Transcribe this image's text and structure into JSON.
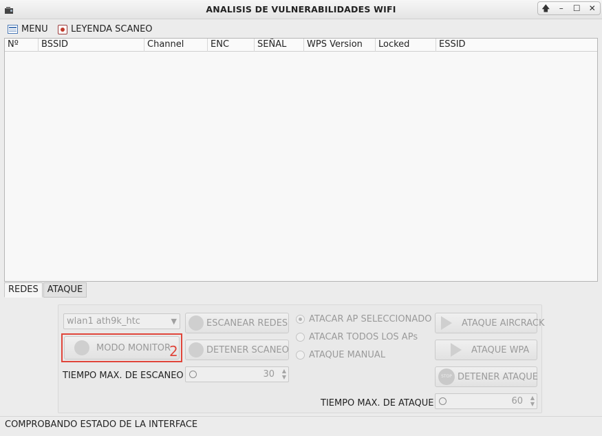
{
  "window": {
    "title": "ANALISIS DE VULNERABILIDADES WIFI",
    "controls": {
      "up": "🡅",
      "minimize": "–",
      "maximize": "☐",
      "close": "✕"
    }
  },
  "menubar": {
    "menu_label": "MENU",
    "legend_label": "LEYENDA SCANEO"
  },
  "table": {
    "columns": [
      "Nº",
      "BSSID",
      "Channel",
      "ENC",
      "SEÑAL",
      "WPS Version",
      "Locked",
      "ESSID"
    ]
  },
  "tabs": [
    "REDES",
    "ATAQUE"
  ],
  "controls": {
    "interface_select": "wlan1 ath9k_htc",
    "scan_button": "ESCANEAR REDES",
    "monitor_button": "MODO MONITOR",
    "stop_scan_button": "DETENER SCANEO",
    "scan_time_label": "TIEMPO MAX. DE ESCANEO",
    "scan_time_value": "30",
    "radio_selected_ap": "ATACAR AP SELECCIONADO",
    "radio_all_aps": "ATACAR TODOS LOS APs",
    "radio_manual": "ATAQUE MANUAL",
    "aircrack_button": "ATAQUE AIRCRACK",
    "wpa_button": "ATAQUE WPA",
    "stop_attack_button": "DETENER ATAQUE",
    "stop_icon_text": "STOP",
    "attack_time_label": "TIEMPO MAX. DE ATAQUE",
    "attack_time_value": "60"
  },
  "annotation": {
    "number": "2",
    "color": "#e0453a"
  },
  "status": {
    "text": "COMPROBANDO ESTADO DE LA INTERFACE"
  },
  "icons": {
    "app": "app-icon",
    "menu": "menu-icon",
    "legend": "legend-icon",
    "scan": "scan-icon",
    "monitor": "lightbulb-icon",
    "stop_scan": "stop-scan-icon",
    "aircrack": "play-icon",
    "wpa": "play-icon",
    "stop_attack": "stop-icon",
    "timer": "clock-icon"
  }
}
